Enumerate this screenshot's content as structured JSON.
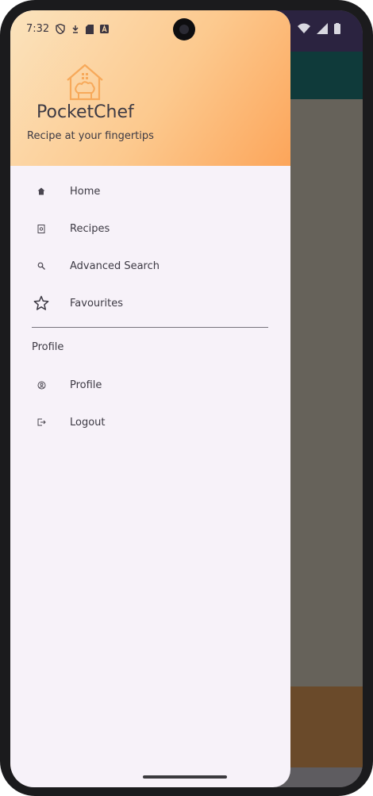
{
  "status_bar": {
    "time": "7:32",
    "left_icons": [
      "shield-icon",
      "notification-icon",
      "sd-card-icon",
      "font-icon"
    ],
    "right_icons": [
      "wifi-icon",
      "signal-icon",
      "battery-icon"
    ]
  },
  "drawer": {
    "app_name": "PocketChef",
    "tagline": "Recipe at your fingertips",
    "logo_icon": "chef-house-icon",
    "accent_color": "#f7a95a",
    "main_items": [
      {
        "label": "Home",
        "icon": "home-icon"
      },
      {
        "label": "Recipes",
        "icon": "book-icon"
      },
      {
        "label": "Advanced Search",
        "icon": "search-icon"
      },
      {
        "label": "Favourites",
        "icon": "star-icon"
      }
    ],
    "section_title": "Profile",
    "profile_items": [
      {
        "label": "Profile",
        "icon": "profile-icon"
      },
      {
        "label": "Logout",
        "icon": "logout-icon"
      }
    ]
  }
}
